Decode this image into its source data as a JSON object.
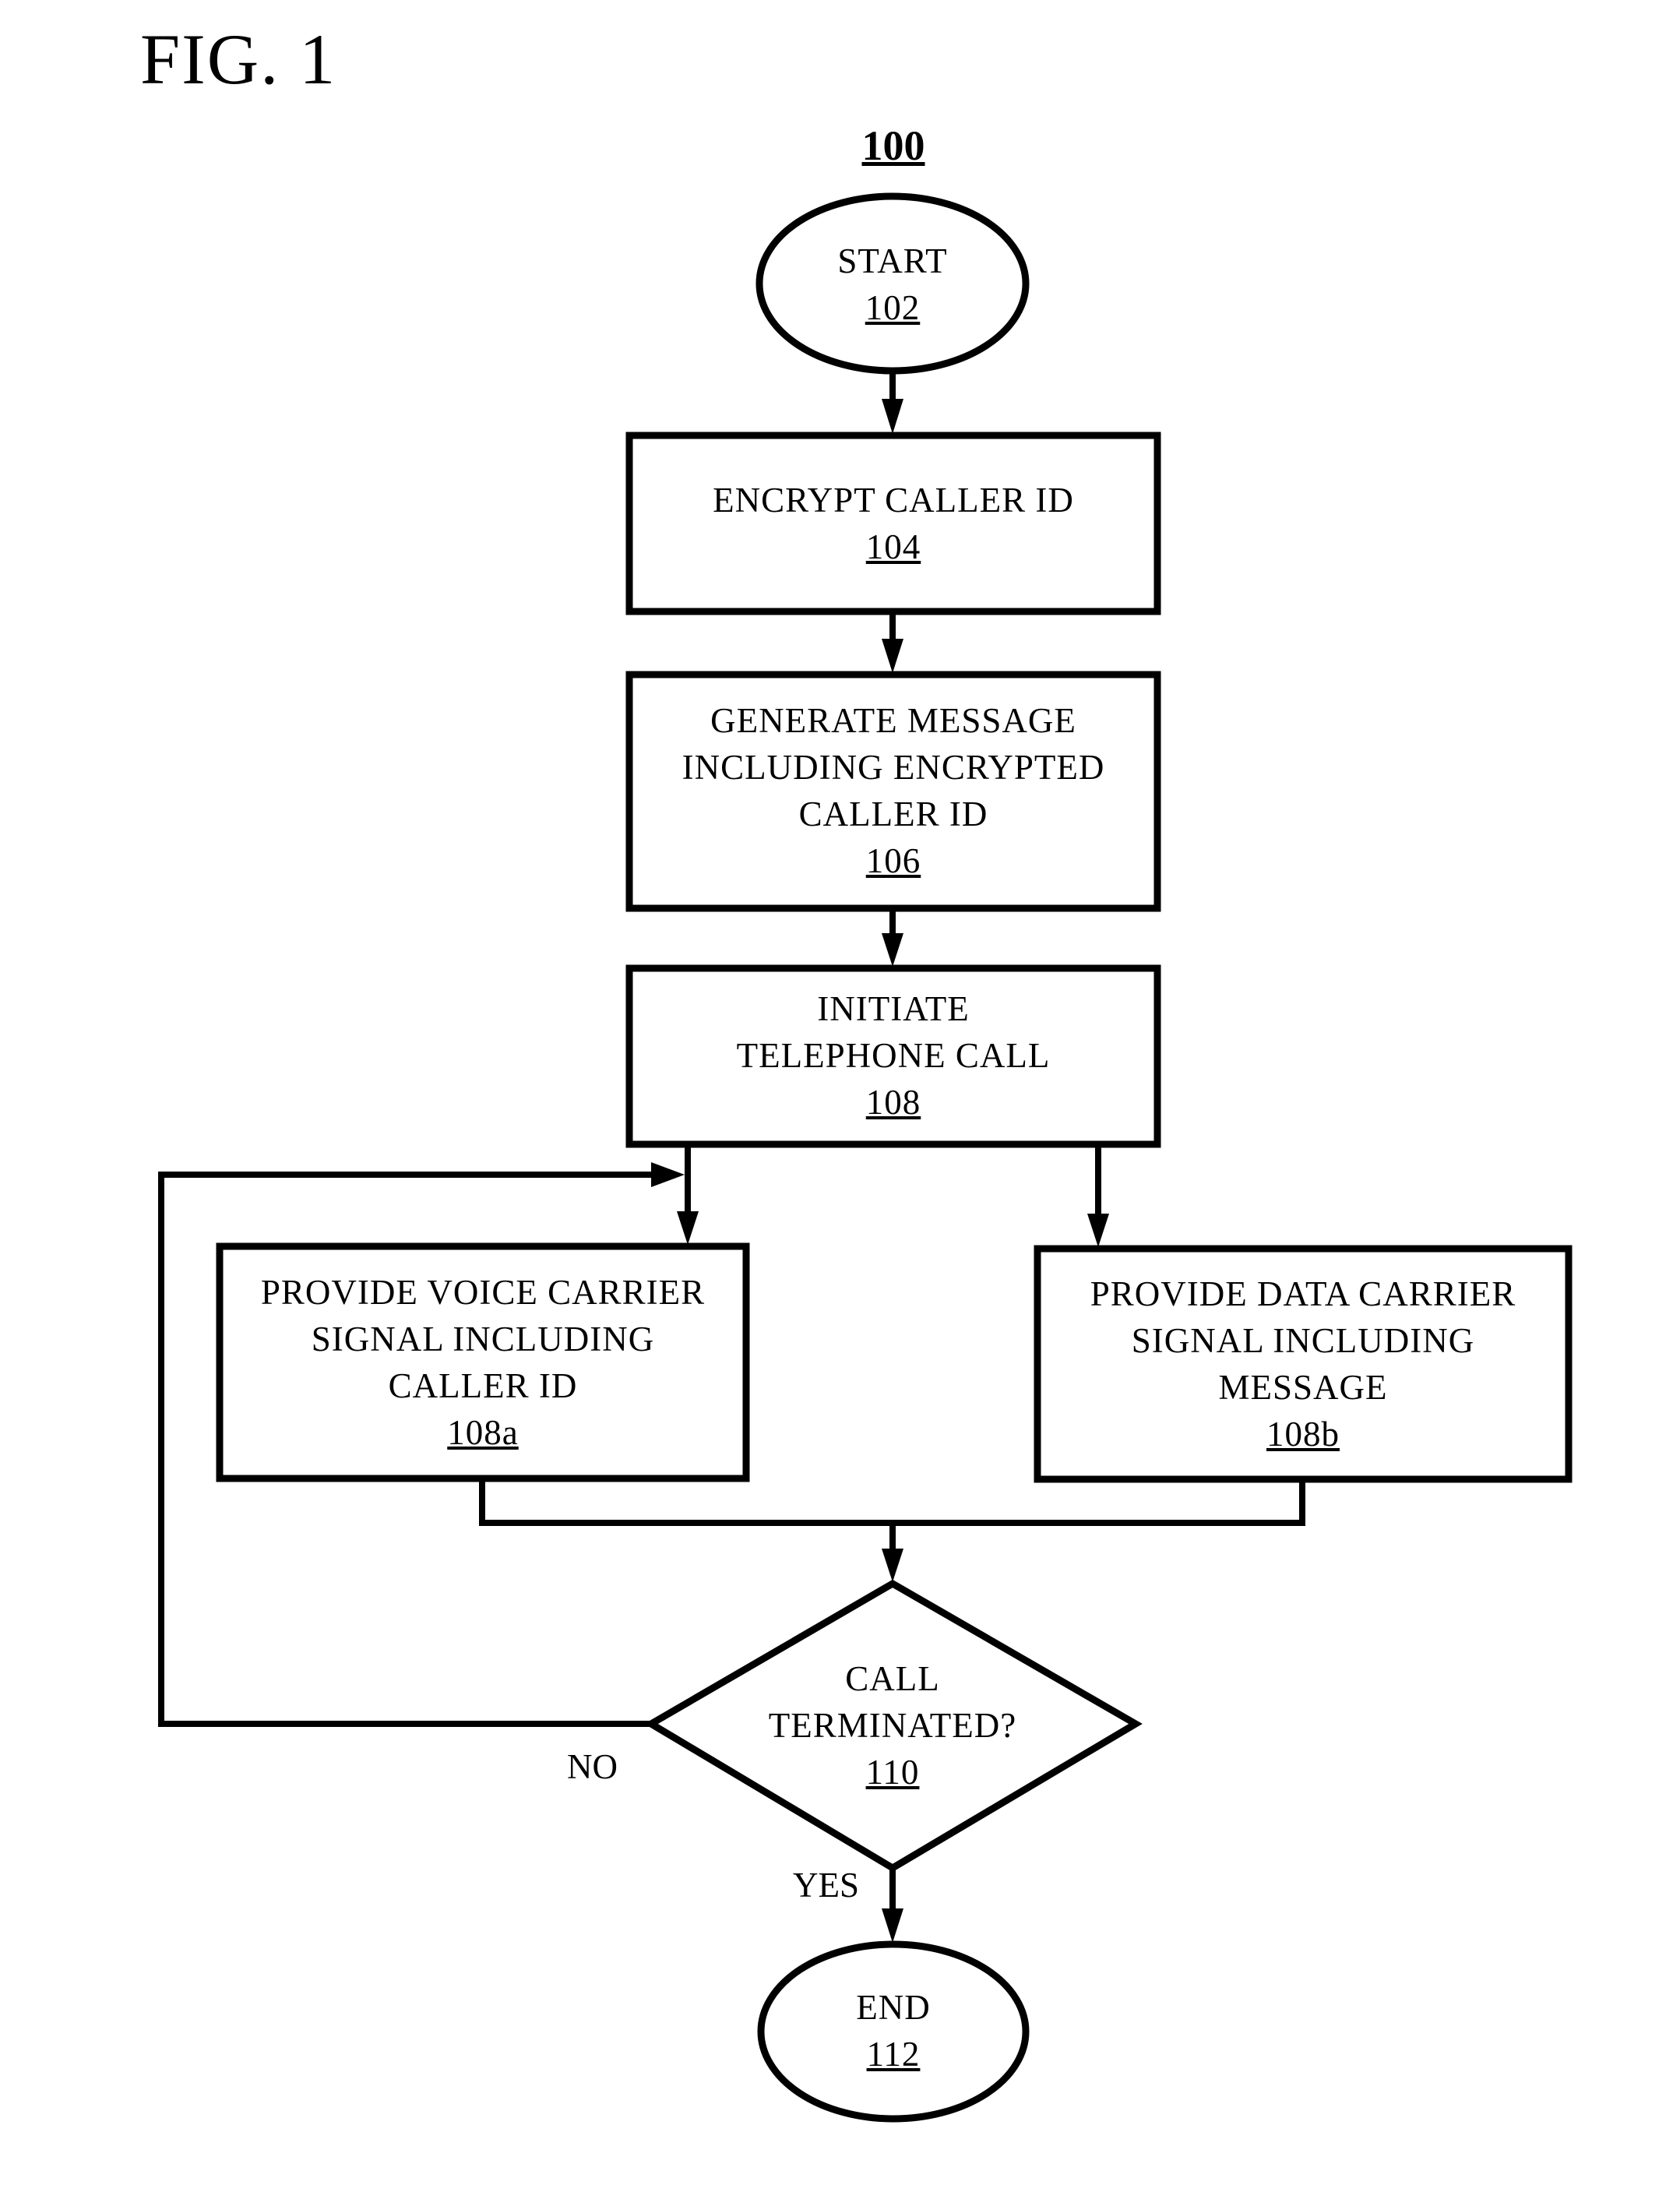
{
  "figure": {
    "title": "FIG. 1",
    "reference": "100"
  },
  "nodes": {
    "start": {
      "type": "terminal",
      "lines": [
        "START"
      ],
      "ref": "102"
    },
    "encrypt": {
      "type": "process",
      "lines": [
        "ENCRYPT CALLER ID"
      ],
      "ref": "104"
    },
    "generate": {
      "type": "process",
      "lines": [
        "GENERATE MESSAGE",
        "INCLUDING ENCRYPTED",
        "CALLER ID"
      ],
      "ref": "106"
    },
    "initiate": {
      "type": "process",
      "lines": [
        "INITIATE",
        "TELEPHONE CALL"
      ],
      "ref": "108"
    },
    "voice": {
      "type": "process",
      "lines": [
        "PROVIDE VOICE CARRIER",
        "SIGNAL INCLUDING",
        "CALLER ID"
      ],
      "ref": "108a"
    },
    "data": {
      "type": "process",
      "lines": [
        "PROVIDE DATA CARRIER",
        "SIGNAL INCLUDING",
        "MESSAGE"
      ],
      "ref": "108b"
    },
    "decision": {
      "type": "decision",
      "lines": [
        "CALL",
        "TERMINATED?"
      ],
      "ref": "110"
    },
    "end": {
      "type": "terminal",
      "lines": [
        "END"
      ],
      "ref": "112"
    }
  },
  "edges": [
    {
      "from": "start",
      "to": "encrypt",
      "label": ""
    },
    {
      "from": "encrypt",
      "to": "generate",
      "label": ""
    },
    {
      "from": "generate",
      "to": "initiate",
      "label": ""
    },
    {
      "from": "initiate",
      "to": "voice",
      "label": ""
    },
    {
      "from": "initiate",
      "to": "data",
      "label": ""
    },
    {
      "from": "voice",
      "to": "decision",
      "label": ""
    },
    {
      "from": "data",
      "to": "decision",
      "label": ""
    },
    {
      "from": "decision",
      "to": "voice",
      "label": "NO"
    },
    {
      "from": "decision",
      "to": "end",
      "label": "YES"
    }
  ],
  "labels": {
    "no": "NO",
    "yes": "YES"
  }
}
